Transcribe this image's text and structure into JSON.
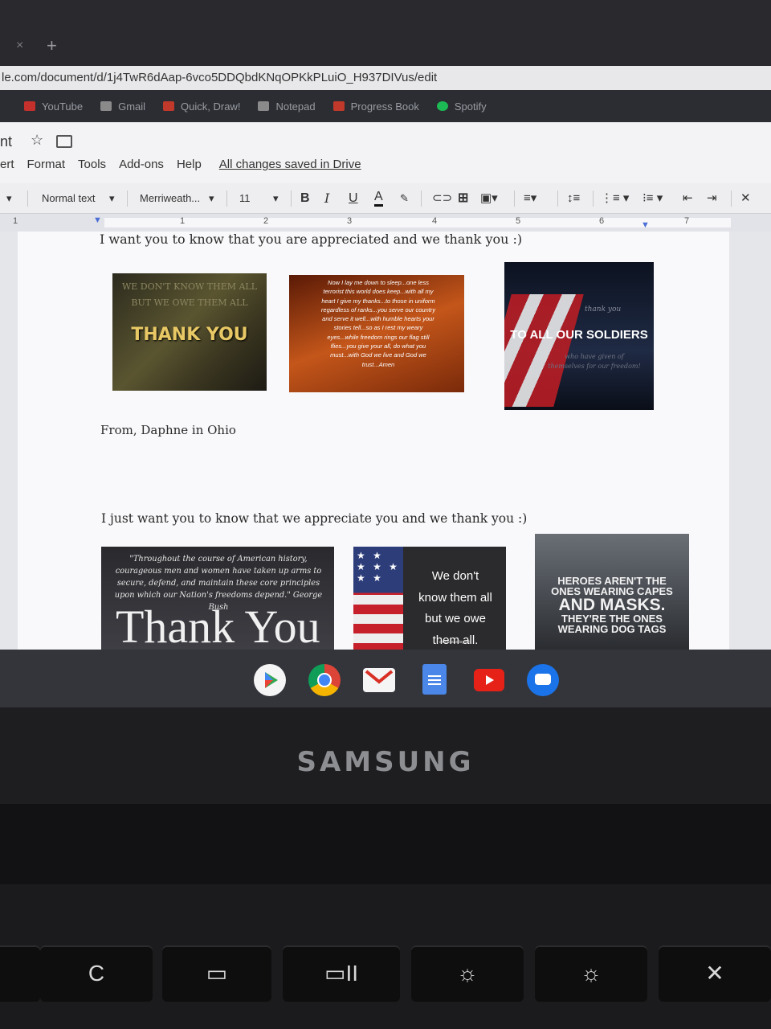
{
  "browser": {
    "tab_close": "×",
    "tab_new": "+",
    "url": "le.com/document/d/1j4TwR6dAap-6vco5DDQbdKNqOPKkPLuiO_H937DIVus/edit",
    "bookmarks": [
      {
        "label": "YouTube",
        "color": "#c4302b"
      },
      {
        "label": "Gmail",
        "color": "#8a8a8a"
      },
      {
        "label": "Quick, Draw!",
        "color": "#c0392b"
      },
      {
        "label": "Notepad",
        "color": "#8a8a8a"
      },
      {
        "label": "Progress Book",
        "color": "#c0392b"
      },
      {
        "label": "Spotify",
        "color": "#1db954"
      }
    ]
  },
  "docs": {
    "title_fragment": "nt",
    "menu": [
      "ert",
      "Format",
      "Tools",
      "Add-ons",
      "Help"
    ],
    "saved_status": "All changes saved in Drive",
    "toolbar": {
      "style": "Normal text",
      "font": "Merriweath...",
      "size": "11",
      "bold": "B",
      "italic": "I",
      "underline": "U",
      "textcolor": "A"
    },
    "ruler_numbers": [
      "1",
      "1",
      "2",
      "3",
      "4",
      "5",
      "6",
      "7"
    ]
  },
  "document": {
    "line1": "I want you to know that you are appreciated and we thank you :)",
    "signature": "From, Daphne in Ohio",
    "line2": "I just want you to know that we appreciate you and we thank you :)",
    "images": {
      "img1": {
        "top": "WE DON'T KNOW THEM ALL",
        "mid": "BUT WE OWE THEM ALL",
        "main": "THANK YOU"
      },
      "img2": {
        "poem": "Now I lay me down to sleep...one less terrorist this world does keep...with all my heart I give my thanks...to those in uniform regardless of ranks...you serve our country and serve it well...with humble hearts your stories tell...so as I rest my weary eyes...while freedom rings our flag still flies...you give your all, do what you must...with God we live and God we trust...Amen"
      },
      "img3": {
        "small": "thank you",
        "main": "TO ALL OUR SOLDIERS",
        "sub": "who have given of themselves for our freedom!"
      },
      "img4": {
        "quote": "\"Throughout the course of American history, courageous men and women have taken up arms to secure, defend, and maintain these core principles upon which our Nation's freedoms depend.\" George Bush",
        "main": "Thank You"
      },
      "img5": {
        "text": [
          "We don't",
          "know them all",
          "but we owe",
          "them all."
        ],
        "credit": "americansday.info"
      },
      "img6": {
        "text": [
          "HEROES AREN'T THE",
          "ONES WEARING CAPES",
          "AND MASKS.",
          "THEY'RE THE ONES",
          "WEARING DOG TAGS"
        ]
      }
    }
  },
  "device": {
    "brand": "SAMSUNG",
    "keys": [
      "C",
      "▭",
      "▭II",
      "☼",
      "☼",
      "✕"
    ]
  }
}
